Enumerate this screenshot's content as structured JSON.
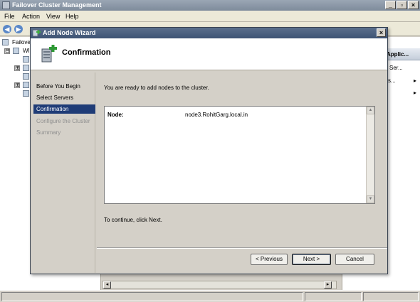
{
  "main_window": {
    "title": "Failover Cluster Management",
    "controls": {
      "minimize": "_",
      "restore": "▫",
      "close": "×"
    },
    "menu": [
      "File",
      "Action",
      "View",
      "Help"
    ],
    "toolbar": {
      "back": "◀",
      "forward": "▶"
    },
    "tree": [
      {
        "label": "Failover",
        "expander": ""
      },
      {
        "label": "WI",
        "expander": "⊟"
      },
      {
        "label": "",
        "expander": "⊞"
      },
      {
        "label": "",
        "expander": "⊞"
      }
    ],
    "actions": {
      "header": "Applic...",
      "items": [
        {
          "label": "Ser...",
          "arrow": ""
        },
        {
          "label": "s...",
          "arrow": "▸"
        },
        {
          "label": "",
          "arrow": "▸"
        }
      ]
    },
    "hscroll": {
      "left": "◂",
      "right": "▸"
    }
  },
  "wizard": {
    "title": "Add Node Wizard",
    "close_label": "×",
    "page_title": "Confirmation",
    "steps": [
      {
        "label": "Before You Begin",
        "state": "done"
      },
      {
        "label": "Select Servers",
        "state": "done"
      },
      {
        "label": "Confirmation",
        "state": "current"
      },
      {
        "label": "Configure the Cluster",
        "state": "disabled"
      },
      {
        "label": "Summary",
        "state": "disabled"
      }
    ],
    "intro": "You are ready to add nodes to the cluster.",
    "summary": {
      "label": "Node:",
      "value": "node3.RohitGarg.local.in"
    },
    "continue_hint": "To continue, click Next.",
    "buttons": {
      "previous": "< Previous",
      "next": "Next >",
      "cancel": "Cancel"
    }
  }
}
